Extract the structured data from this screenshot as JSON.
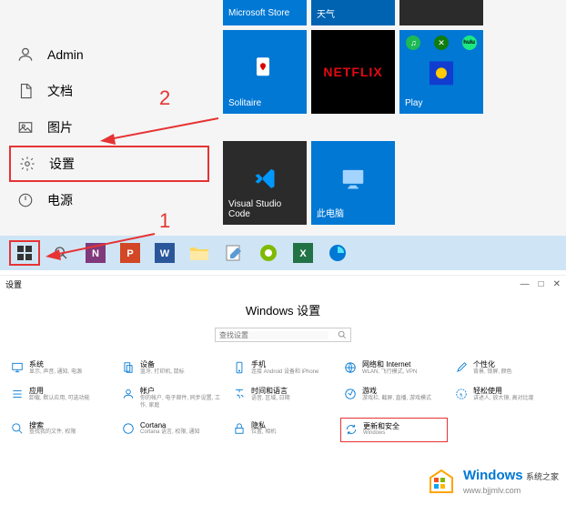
{
  "start_menu": {
    "items": [
      {
        "label": "Admin",
        "icon": "person-icon"
      },
      {
        "label": "文档",
        "icon": "document-icon"
      },
      {
        "label": "图片",
        "icon": "pictures-icon"
      },
      {
        "label": "设置",
        "icon": "gear-icon"
      },
      {
        "label": "电源",
        "icon": "power-icon"
      }
    ],
    "tiles": {
      "msstore": "Microsoft Store",
      "weather": "天气",
      "solitaire": "Solitaire",
      "netflix": "NETFLIX",
      "play": "Play",
      "vscode": "Visual Studio Code",
      "thispc": "此电脑"
    },
    "annotations": {
      "num1": "1",
      "num2": "2"
    }
  },
  "settings_window": {
    "window_title": "设置",
    "title": "Windows 设置",
    "search_placeholder": "查找设置",
    "controls": {
      "min": "—",
      "max": "□",
      "close": "✕"
    },
    "items": [
      {
        "title": "系统",
        "desc": "显示, 声音, 通知, 电源"
      },
      {
        "title": "设备",
        "desc": "蓝牙, 打印机, 鼠标"
      },
      {
        "title": "手机",
        "desc": "连接 Android 设备和 iPhone"
      },
      {
        "title": "网络和 Internet",
        "desc": "WLAN, 飞行模式, VPN"
      },
      {
        "title": "个性化",
        "desc": "背景, 锁屏, 颜色"
      },
      {
        "title": "应用",
        "desc": "卸载, 默认应用, 可选功能"
      },
      {
        "title": "帐户",
        "desc": "你的帐户, 电子邮件, 同步设置, 工作, 家庭"
      },
      {
        "title": "时间和语言",
        "desc": "语音, 区域, 日期"
      },
      {
        "title": "游戏",
        "desc": "游戏栏, 截屏, 直播, 游戏模式"
      },
      {
        "title": "轻松使用",
        "desc": "讲述人, 放大镜, 高对比度"
      },
      {
        "title": "搜索",
        "desc": "查找我的文件, 权限"
      },
      {
        "title": "Cortana",
        "desc": "Cortana 语言, 权限, 通知"
      },
      {
        "title": "隐私",
        "desc": "位置, 相机"
      },
      {
        "title": "更新和安全",
        "desc": "Windows"
      }
    ]
  },
  "watermark": {
    "main": "Windows",
    "sub1": "系统之家",
    "sub2": "www.bjjmlv.com"
  }
}
